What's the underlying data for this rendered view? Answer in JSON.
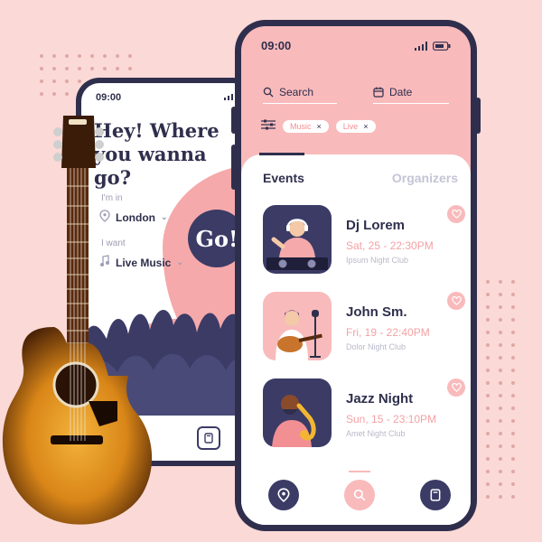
{
  "colors": {
    "background": "#fbd9d6",
    "navy": "#2f2f4d",
    "accent_pink": "#f9babb",
    "date_pink": "#f4a1a4",
    "muted": "#c4c4d6"
  },
  "back_phone": {
    "time": "09:00",
    "headline": "Hey! Where you wanna go?",
    "location_label": "I'm in",
    "location_value": "London",
    "want_label": "I want",
    "want_value": "Live Music",
    "go_button": "Go!",
    "nav_icons": [
      "search-icon",
      "card-icon"
    ]
  },
  "main_phone": {
    "time": "09:00",
    "search_placeholder": "Search",
    "date_placeholder": "Date",
    "filters": [
      {
        "label": "Music",
        "remove": "×"
      },
      {
        "label": "Live",
        "remove": "×"
      }
    ],
    "tabs": {
      "active": "Events",
      "inactive": "Organizers"
    },
    "events": [
      {
        "title": "Dj Lorem",
        "date": "Sat, 25 - 22:30PM",
        "venue": "Ipsum Night Club",
        "icon": "dj-illustration"
      },
      {
        "title": "John Sm.",
        "date": "Fri, 19 - 22:40PM",
        "venue": "Dolor Night Club",
        "icon": "guitarist-illustration"
      },
      {
        "title": "Jazz Night",
        "date": "Sun, 15 - 23:10PM",
        "venue": "Amet Night Club",
        "icon": "saxophonist-illustration"
      }
    ],
    "bottom_nav": [
      "location-pin-icon",
      "search-icon",
      "card-icon"
    ]
  }
}
